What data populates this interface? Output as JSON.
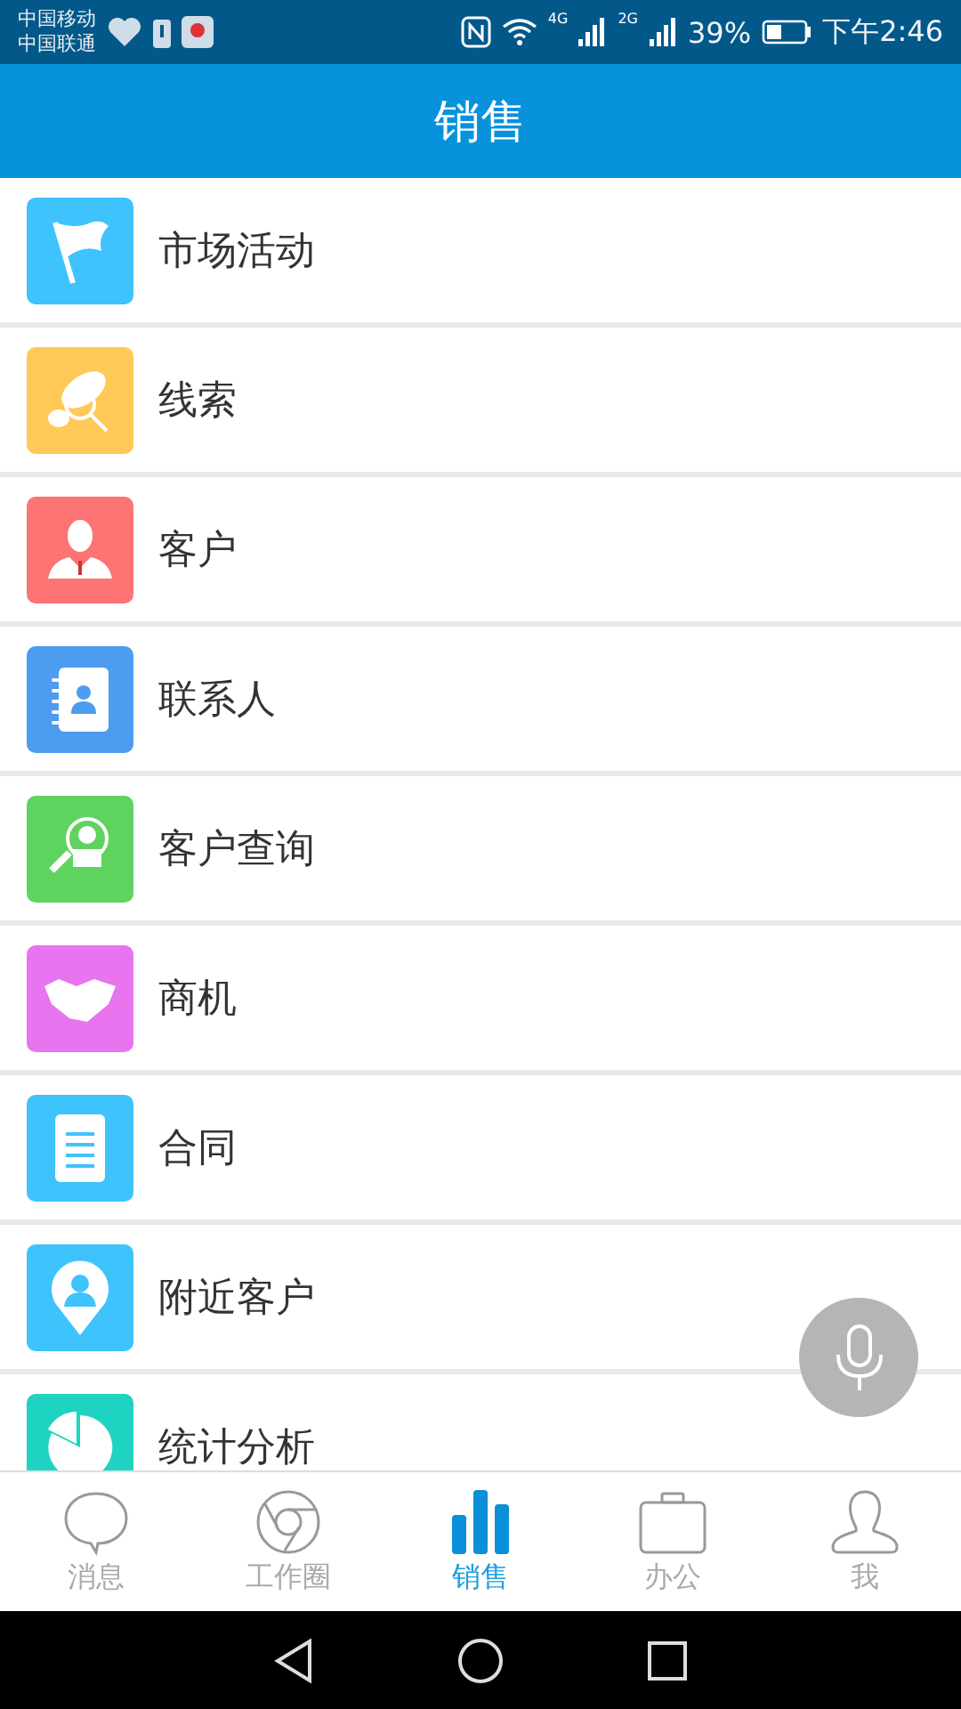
{
  "status_bar": {
    "carriers": [
      "中国移动",
      "中国联通"
    ],
    "network_labels": [
      "4G",
      "2G"
    ],
    "battery_percent": "39%",
    "time": "下午2:46"
  },
  "header": {
    "title": "销售"
  },
  "menu_items": [
    {
      "label": "市场活动",
      "kind": "flag",
      "color": "#3ec3fd"
    },
    {
      "label": "线索",
      "kind": "search",
      "color": "#fec957"
    },
    {
      "label": "客户",
      "kind": "person",
      "color": "#fc7474"
    },
    {
      "label": "联系人",
      "kind": "contacts",
      "color": "#4c9cf0"
    },
    {
      "label": "客户查询",
      "kind": "lookup",
      "color": "#5fd35f"
    },
    {
      "label": "商机",
      "kind": "handshake",
      "color": "#e874f0"
    },
    {
      "label": "合同",
      "kind": "document",
      "color": "#3ec3fd"
    },
    {
      "label": "附近客户",
      "kind": "pin",
      "color": "#3ec3fd"
    },
    {
      "label": "统计分析",
      "kind": "pie",
      "color": "#1fd3c3"
    }
  ],
  "tabs": [
    {
      "label": "消息",
      "kind": "chat",
      "selected": false
    },
    {
      "label": "工作圈",
      "kind": "circle",
      "selected": false
    },
    {
      "label": "销售",
      "kind": "bars",
      "selected": true
    },
    {
      "label": "办公",
      "kind": "briefcase",
      "selected": false
    },
    {
      "label": "我",
      "kind": "user",
      "selected": false
    }
  ]
}
